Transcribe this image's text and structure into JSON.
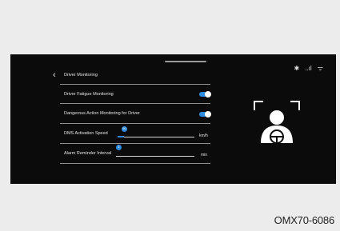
{
  "page": {
    "title": "Driver Monitoring",
    "reference_code": "OMX70-6086"
  },
  "status_bar": {
    "icons": [
      "bluetooth-icon",
      "signal-icon",
      "wifi-icon"
    ],
    "bluetooth_glyph": "✱",
    "signal_glyph": "..ıl",
    "wifi_glyph": "ᯤ"
  },
  "settings": {
    "driver_fatigue": {
      "label": "Driver Fatigue Monitoring",
      "enabled": true
    },
    "dangerous_action": {
      "label": "Dangerous Action Monitoring for Driver",
      "enabled": true
    },
    "dms_speed": {
      "label": "DMS Activation Speed",
      "value": "60",
      "unit": "km/h",
      "level": 0.02
    },
    "alarm_interval": {
      "label": "Alarm Reminder Interval",
      "value": "3",
      "unit": "min",
      "level": 0.0
    }
  },
  "colors": {
    "accent": "#2f8be0",
    "background": "#0b0b0b"
  }
}
